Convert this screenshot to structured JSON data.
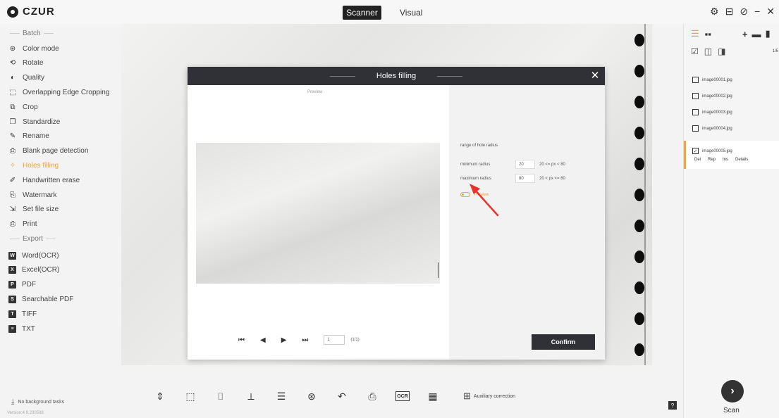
{
  "app": {
    "logo_text": "CZUR",
    "version": "Version:4.9.230508",
    "accent_color": "#f2a23a",
    "dark_color": "#2f3136"
  },
  "mode_tabs": [
    {
      "label": "Scanner",
      "active": true
    },
    {
      "label": "Visual",
      "active": false
    }
  ],
  "window_controls": [
    {
      "icon": "gear-icon",
      "glyph": "⚙"
    },
    {
      "icon": "message-icon",
      "glyph": "⊟"
    },
    {
      "icon": "help-icon",
      "glyph": "⊘"
    },
    {
      "icon": "minimize-icon",
      "glyph": "−"
    },
    {
      "icon": "close-icon",
      "glyph": "✕"
    }
  ],
  "sidebar": {
    "batch_header": "Batch",
    "batch_items": [
      {
        "label": "Color mode",
        "icon": "color-mode-icon",
        "glyph": "⊛"
      },
      {
        "label": "Rotate",
        "icon": "rotate-icon",
        "glyph": "⟲"
      },
      {
        "label": "Quality",
        "icon": "quality-icon",
        "glyph": "◐"
      },
      {
        "label": "Overlapping Edge Cropping",
        "icon": "edge-crop-icon",
        "glyph": "⬚"
      },
      {
        "label": "Crop",
        "icon": "crop-icon",
        "glyph": "⧉"
      },
      {
        "label": "Standardize",
        "icon": "standardize-icon",
        "glyph": "❐"
      },
      {
        "label": "Rename",
        "icon": "rename-icon",
        "glyph": "✎"
      },
      {
        "label": "Blank page detection",
        "icon": "blank-page-icon",
        "glyph": "⎙"
      },
      {
        "label": "Holes filling",
        "icon": "holes-filling-icon",
        "glyph": "✧",
        "active": true
      },
      {
        "label": "Handwritten erase",
        "icon": "eraser-icon",
        "glyph": "✐"
      },
      {
        "label": "Watermark",
        "icon": "watermark-icon",
        "glyph": "⎘"
      },
      {
        "label": "Set file size",
        "icon": "file-size-icon",
        "glyph": "⇲"
      },
      {
        "label": "Print",
        "icon": "print-icon",
        "glyph": "⎙"
      }
    ],
    "export_header": "Export",
    "export_items": [
      {
        "label": "Word(OCR)",
        "icon": "word-icon",
        "glyph": "W"
      },
      {
        "label": "Excel(OCR)",
        "icon": "excel-icon",
        "glyph": "X"
      },
      {
        "label": "PDF",
        "icon": "pdf-icon",
        "glyph": "P"
      },
      {
        "label": "Searchable PDF",
        "icon": "searchable-pdf-icon",
        "glyph": "S"
      },
      {
        "label": "TIFF",
        "icon": "tiff-icon",
        "glyph": "T"
      },
      {
        "label": "TXT",
        "icon": "txt-icon",
        "glyph": "≡"
      }
    ],
    "background_tasks": "No background tasks"
  },
  "dialog": {
    "title": "Holes filling",
    "preview_label": "Preview",
    "range_label": "range of hole radius",
    "min_label": "minimum radius",
    "min_value": "20",
    "min_range": "20 <= px < 80",
    "max_label": "maximum radius",
    "max_value": "80",
    "max_range": "20 < px <= 80",
    "preview_toggle_label": "Preview",
    "page_value": "1",
    "page_total": "(1/1)",
    "confirm_label": "Confirm"
  },
  "right_panel": {
    "page_counter": "1/5",
    "files": [
      {
        "name": "image00001.jpg",
        "checked": false
      },
      {
        "name": "image00002.jpg",
        "checked": false
      },
      {
        "name": "image00003.jpg",
        "checked": false
      },
      {
        "name": "image00004.jpg",
        "checked": false
      },
      {
        "name": "image00005.jpg",
        "checked": true
      }
    ],
    "file_actions": [
      "Del",
      "Rep",
      "Ins",
      "Details"
    ],
    "scan_label": "Scan"
  },
  "toolbar": {
    "tools": [
      {
        "icon": "fit-icon",
        "glyph": "⇕"
      },
      {
        "icon": "select-icon",
        "glyph": "⬚"
      },
      {
        "icon": "crop-icon",
        "glyph": "⌷"
      },
      {
        "icon": "rotate-crop-icon",
        "glyph": "⟂"
      },
      {
        "icon": "adjust-icon",
        "glyph": "☰"
      },
      {
        "icon": "color-icon",
        "glyph": "⊛"
      },
      {
        "icon": "undo-icon",
        "glyph": "↶"
      },
      {
        "icon": "print-icon",
        "glyph": "⎙"
      },
      {
        "icon": "ocr-icon",
        "glyph": "OCR"
      },
      {
        "icon": "qr-icon",
        "glyph": "▦"
      }
    ],
    "aux_label": "Auxiliary correction"
  }
}
